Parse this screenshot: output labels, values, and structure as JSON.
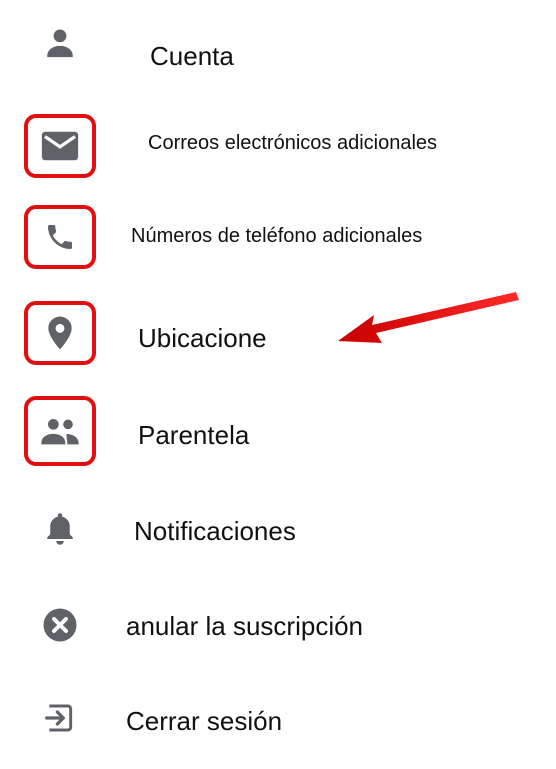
{
  "colors": {
    "icon": "#5f6368",
    "highlight": "#e01010",
    "arrow": "#e01010",
    "text": "#111111",
    "background": "#ffffff"
  },
  "menu": {
    "items": [
      {
        "label": "Cuenta",
        "icon": "person-icon",
        "highlighted": false
      },
      {
        "label": "Correos electrónicos adicionales",
        "icon": "mail-icon",
        "highlighted": true
      },
      {
        "label": "Números de teléfono adicionales",
        "icon": "phone-icon",
        "highlighted": true
      },
      {
        "label": "Ubicacione",
        "icon": "location-pin-icon",
        "highlighted": true
      },
      {
        "label": "Parentela",
        "icon": "people-icon",
        "highlighted": true
      },
      {
        "label": "Notificaciones",
        "icon": "bell-icon",
        "highlighted": false
      },
      {
        "label": "anular la suscripción",
        "icon": "cancel-circle-icon",
        "highlighted": false
      },
      {
        "label": "Cerrar sesión",
        "icon": "logout-icon",
        "highlighted": false
      }
    ]
  },
  "annotation": {
    "arrow_icon": "red-arrow-icon",
    "arrow_target": "Ubicacione"
  }
}
